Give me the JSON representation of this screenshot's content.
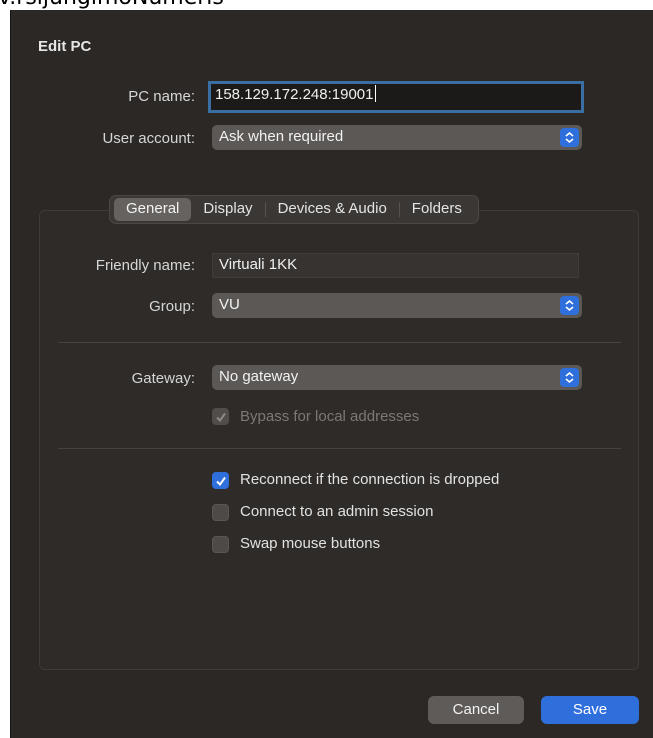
{
  "top_strip_text": "v.rsijungimoNumeris",
  "dialog": {
    "title": "Edit PC",
    "pc_name_label": "PC name:",
    "pc_name_value": "158.129.172.248:19001",
    "user_account_label": "User account:",
    "user_account_value": "Ask when required"
  },
  "tabs": [
    {
      "label": "General",
      "active": true
    },
    {
      "label": "Display",
      "active": false
    },
    {
      "label": "Devices & Audio",
      "active": false
    },
    {
      "label": "Folders",
      "active": false
    }
  ],
  "general": {
    "friendly_name_label": "Friendly name:",
    "friendly_name_value": "Virtuali 1KK",
    "group_label": "Group:",
    "group_value": "VU",
    "gateway_label": "Gateway:",
    "gateway_value": "No gateway",
    "bypass_label": "Bypass for local addresses",
    "bypass_checked": true,
    "bypass_enabled": false,
    "reconnect_label": "Reconnect if the connection is dropped",
    "reconnect_checked": true,
    "admin_session_label": "Connect to an admin session",
    "admin_session_checked": false,
    "swap_mouse_label": "Swap mouse buttons",
    "swap_mouse_checked": false
  },
  "buttons": {
    "cancel": "Cancel",
    "save": "Save"
  },
  "colors": {
    "accent": "#2f6fdb",
    "focus_ring": "#3b6ea3",
    "sheet_bg": "#2b2826"
  }
}
